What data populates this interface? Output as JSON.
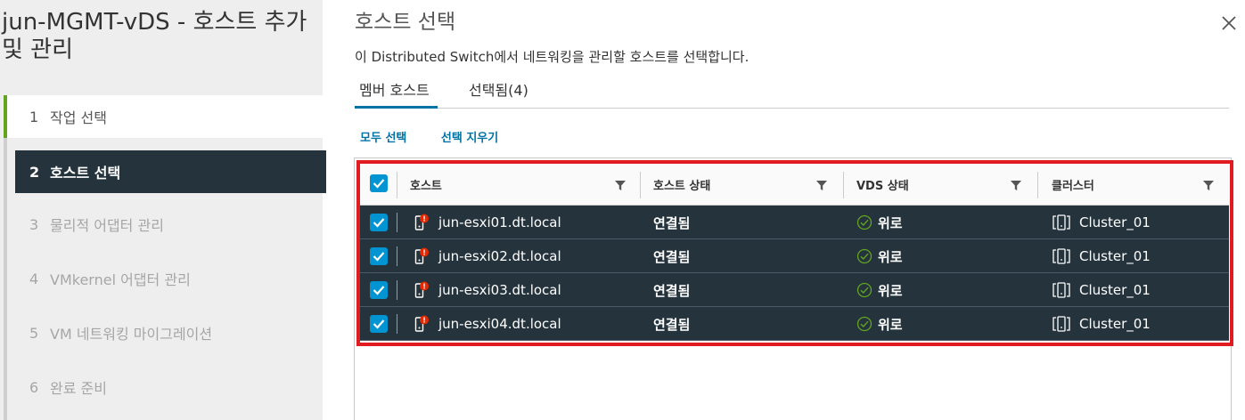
{
  "wizard": {
    "title": "jun-MGMT-vDS - 호스트 추가 및 관리",
    "steps": [
      {
        "num": "1",
        "label": "작업 선택"
      },
      {
        "num": "2",
        "label": "호스트 선택"
      },
      {
        "num": "3",
        "label": "물리적 어댑터 관리"
      },
      {
        "num": "4",
        "label": "VMkernel 어댑터 관리"
      },
      {
        "num": "5",
        "label": "VM 네트워킹 마이그레이션"
      },
      {
        "num": "6",
        "label": "완료 준비"
      }
    ]
  },
  "page": {
    "title": "호스트 선택",
    "description": "이 Distributed Switch에서 네트워킹을 관리할 호스트를 선택합니다.",
    "tabs": [
      {
        "label": "멤버 호스트"
      },
      {
        "label": "선택됨(4)"
      }
    ],
    "actions": {
      "select_all": "모두 선택",
      "clear_selection": "선택 지우기"
    }
  },
  "grid": {
    "columns": [
      "호스트",
      "호스트 상태",
      "VDS 상태",
      "클러스터"
    ],
    "rows": [
      {
        "host": "jun-esxi01.dt.local",
        "host_status": "연결됨",
        "vds_status": "위로",
        "cluster": "Cluster_01"
      },
      {
        "host": "jun-esxi02.dt.local",
        "host_status": "연결됨",
        "vds_status": "위로",
        "cluster": "Cluster_01"
      },
      {
        "host": "jun-esxi03.dt.local",
        "host_status": "연결됨",
        "vds_status": "위로",
        "cluster": "Cluster_01"
      },
      {
        "host": "jun-esxi04.dt.local",
        "host_status": "연결됨",
        "vds_status": "위로",
        "cluster": "Cluster_01"
      }
    ]
  },
  "icons": {
    "close": "close-icon",
    "filter": "filter-icon",
    "host": "host-warning-icon",
    "status_ok": "check-circle-icon",
    "cluster": "cluster-icon",
    "checkbox": "checkbox-checked-icon"
  },
  "colors": {
    "selected_row": "#25333d",
    "accent": "#0072a3",
    "checkbox": "#0094d2",
    "highlight": "#e01b22",
    "progress_done": "#62a420",
    "warning": "#e62700"
  }
}
